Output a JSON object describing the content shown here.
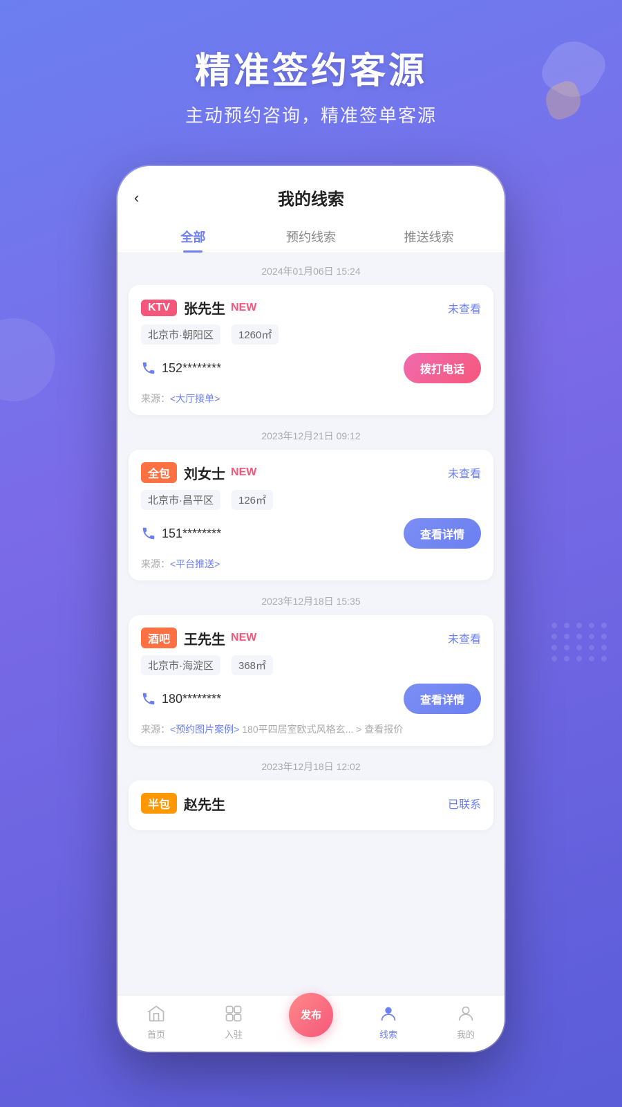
{
  "background": {
    "gradient_start": "#6b7ff0",
    "gradient_end": "#5a5cd8"
  },
  "header": {
    "title": "精准签约客源",
    "subtitle": "主动预约咨询，精准签单客源"
  },
  "phone": {
    "topbar": {
      "back_icon": "‹",
      "page_title": "我的线索"
    },
    "tabs": [
      {
        "label": "全部",
        "active": true
      },
      {
        "label": "预约线索",
        "active": false
      },
      {
        "label": "推送线索",
        "active": false
      }
    ],
    "leads": [
      {
        "date": "2024年01月06日 15:24",
        "tag": "KTV",
        "tag_class": "tag-ktv",
        "name": "张先生",
        "is_new": true,
        "new_label": "NEW",
        "status": "未查看",
        "location": "北京市·朝阳区",
        "area": "1260㎡",
        "phone": "152********",
        "action": "拨打电话",
        "action_class": "call-btn",
        "source": "来源：<大厅接单>",
        "source_link": "<大厅接单>"
      },
      {
        "date": "2023年12月21日 09:12",
        "tag": "全包",
        "tag_class": "tag-quanbao",
        "name": "刘女士",
        "is_new": true,
        "new_label": "NEW",
        "status": "未查看",
        "location": "北京市·昌平区",
        "area": "126㎡",
        "phone": "151********",
        "action": "查看详情",
        "action_class": "detail-btn",
        "source": "来源：<平台推送>",
        "source_link": "<平台推送>"
      },
      {
        "date": "2023年12月18日 15:35",
        "tag": "酒吧",
        "tag_class": "tag-jiuba",
        "name": "王先生",
        "is_new": true,
        "new_label": "NEW",
        "status": "未查看",
        "location": "北京市·海淀区",
        "area": "368㎡",
        "phone": "180********",
        "action": "查看详情",
        "action_class": "detail-btn",
        "source": "来源：<预约图片案例> 180平四居室欧式风格玄... > 查看报价",
        "source_link": "<预约图片案例>"
      },
      {
        "date": "2023年12月18日 12:02",
        "tag": "半包",
        "tag_class": "tag-banbao",
        "name": "赵先生",
        "is_new": false,
        "new_label": "",
        "status": "已联系",
        "location": "",
        "area": "",
        "phone": "",
        "action": "",
        "action_class": "",
        "source": "",
        "source_link": ""
      }
    ],
    "bottom_nav": [
      {
        "label": "首页",
        "icon": "home",
        "active": false
      },
      {
        "label": "入驻",
        "icon": "enter",
        "active": false
      },
      {
        "label": "发布",
        "icon": "publish",
        "active": false,
        "is_publish": true
      },
      {
        "label": "线索",
        "icon": "leads",
        "active": true
      },
      {
        "label": "我的",
        "icon": "profile",
        "active": false
      }
    ]
  }
}
